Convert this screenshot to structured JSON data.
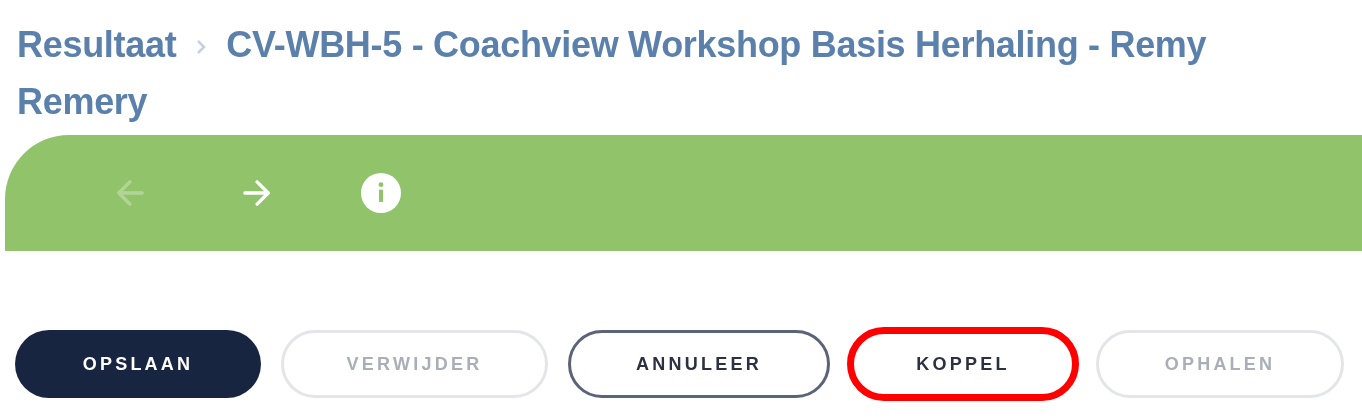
{
  "breadcrumb": [
    {
      "label": "Resultaat"
    },
    {
      "lines": [
        "CV-WBH-5 - Coachview Workshop Basis Herhaling - Remy",
        "Remery"
      ]
    }
  ],
  "toolbar": [
    {
      "kind": "back",
      "disabled": true
    },
    {
      "kind": "forward",
      "disabled": false
    },
    {
      "kind": "info",
      "disabled": false
    }
  ],
  "buttons": [
    {
      "label": "OPSLAAN",
      "kind": "primary",
      "disabled": false,
      "highlighted": false
    },
    {
      "label": "VERWIJDER",
      "kind": "outline",
      "disabled": true,
      "highlighted": false
    },
    {
      "label": "ANNULEER",
      "kind": "outline",
      "disabled": false,
      "highlighted": false
    },
    {
      "label": "KOPPEL",
      "kind": "outline",
      "disabled": false,
      "highlighted": true
    },
    {
      "label": "OPHALEN",
      "kind": "outline",
      "disabled": true,
      "highlighted": false
    }
  ]
}
